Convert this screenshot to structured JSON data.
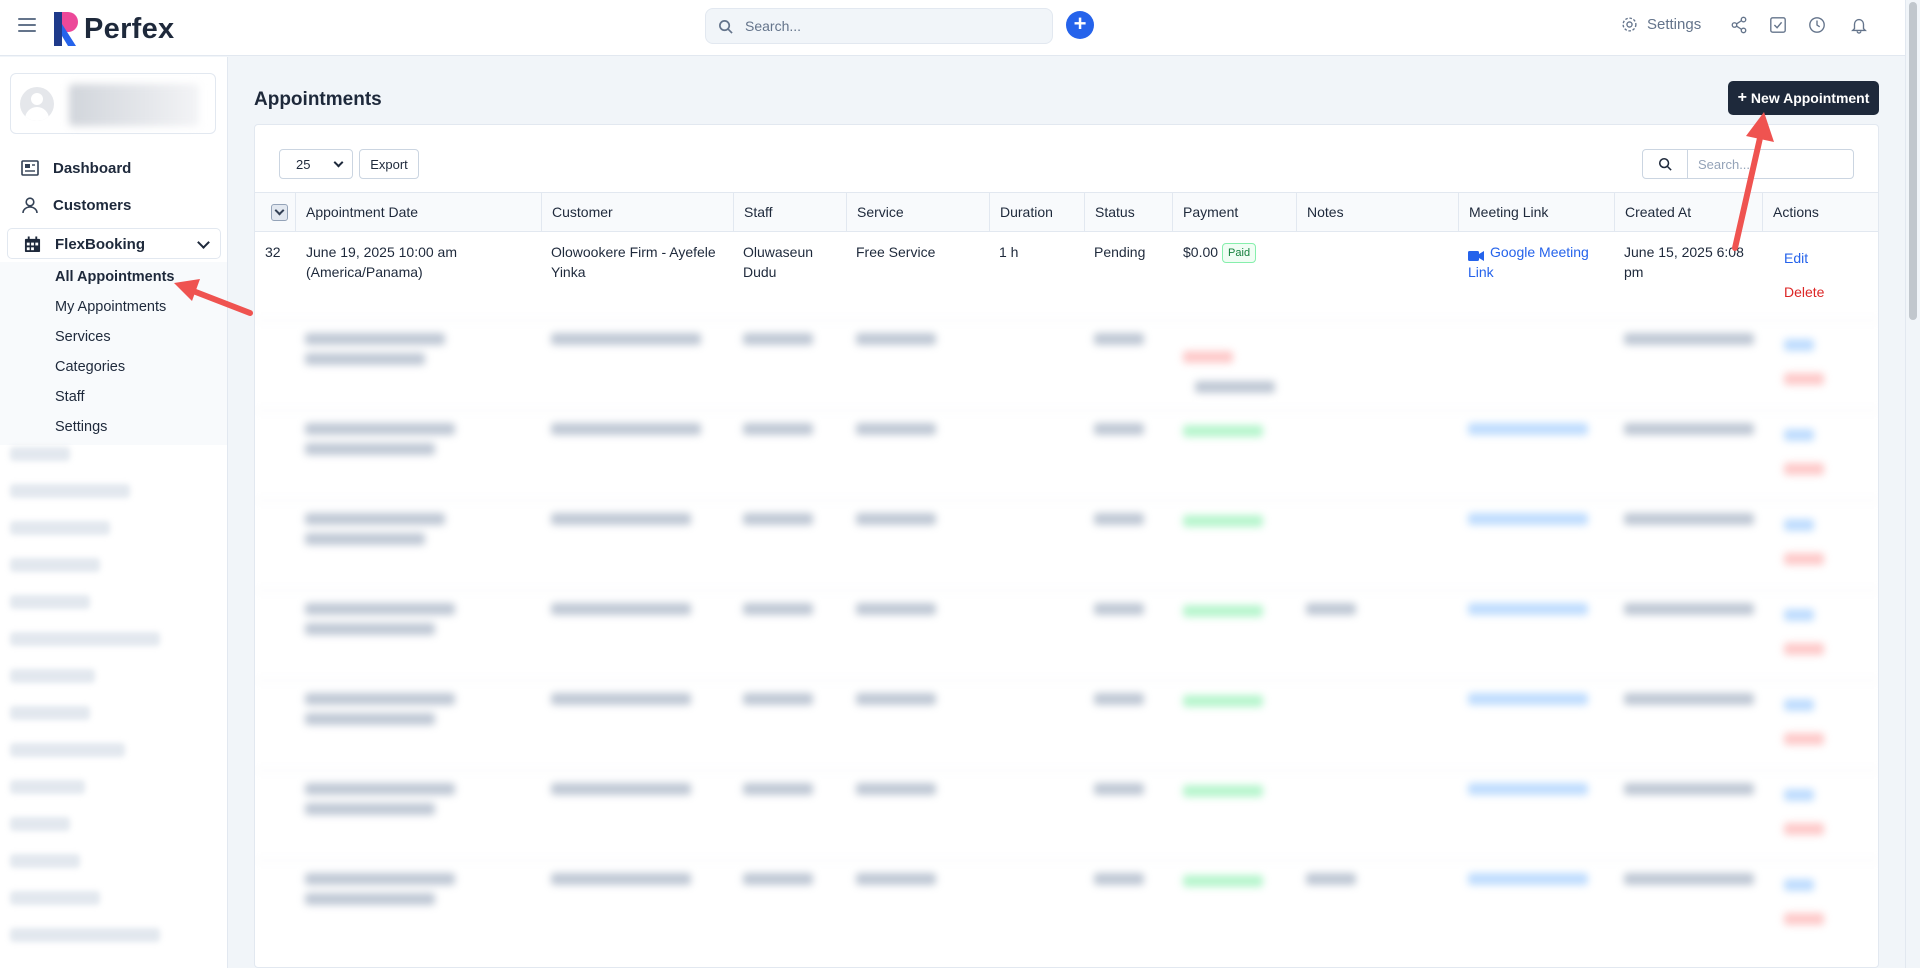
{
  "app": {
    "logo_text": "Perfex",
    "top_search_placeholder": "Search...",
    "settings_label": "Settings"
  },
  "sidebar": {
    "items": [
      {
        "label": "Dashboard",
        "icon": "dashboard-icon"
      },
      {
        "label": "Customers",
        "icon": "user-icon"
      }
    ],
    "group": {
      "label": "FlexBooking",
      "icon": "calendar-icon",
      "expanded": true
    },
    "sub_items": [
      {
        "label": "All Appointments",
        "active": true
      },
      {
        "label": "My Appointments",
        "active": false
      },
      {
        "label": "Services",
        "active": false
      },
      {
        "label": "Categories",
        "active": false
      },
      {
        "label": "Staff",
        "active": false
      },
      {
        "label": "Settings",
        "active": false
      }
    ]
  },
  "page": {
    "title": "Appointments",
    "new_button_label": "New Appointment",
    "new_button_icon": "+"
  },
  "table": {
    "page_length": "25",
    "export_label": "Export",
    "search_placeholder": "Search...",
    "columns": [
      "Appointment Date",
      "Customer",
      "Staff",
      "Service",
      "Duration",
      "Status",
      "Payment",
      "Notes",
      "Meeting Link",
      "Created At",
      "Actions"
    ],
    "rows": [
      {
        "id": "32",
        "date_line1": "June 19, 2025 10:00 am",
        "date_line2": "(America/Panama)",
        "customer_line1": "Olowookere Firm - Ayefele",
        "customer_line2": "Yinka",
        "staff_line1": "Oluwaseun",
        "staff_line2": "Dudu",
        "service": "Free Service",
        "duration": "1 h",
        "status": "Pending",
        "payment_amount": "$0.00",
        "payment_badge": "Paid",
        "notes": "",
        "meeting_link_line1": "Google Meeting",
        "meeting_link_line2": "Link",
        "created_line1": "June 15, 2025 6:08",
        "created_line2": "pm",
        "edit_label": "Edit",
        "delete_label": "Delete"
      }
    ]
  },
  "colors": {
    "primary": "#2563eb",
    "dark_button": "#1e293b",
    "danger": "#dc2626",
    "success": "#15803d",
    "annotation_arrow": "#ef5350"
  }
}
